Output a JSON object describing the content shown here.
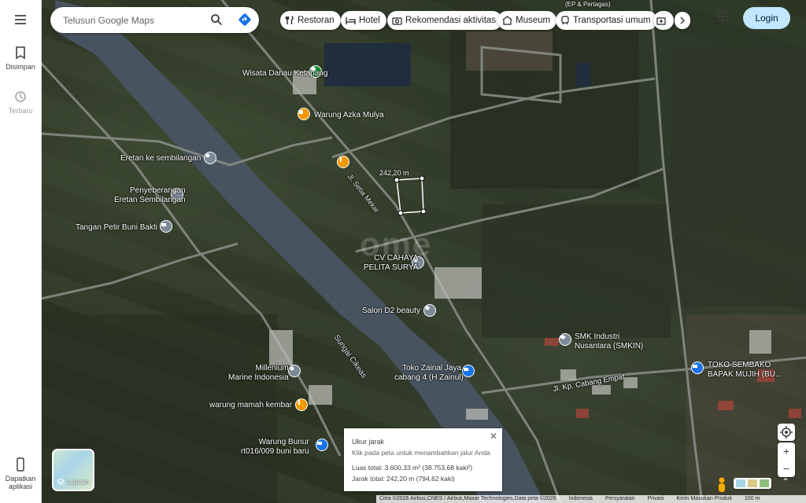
{
  "rail": {
    "saved_label": "Disimpan",
    "recent_label": "Terbaru",
    "get_app_label": "Dapatkan aplikasi"
  },
  "search": {
    "placeholder": "Telusuri Google Maps"
  },
  "chips": [
    "Restoran",
    "Hotel",
    "Rekomendasi aktivitas",
    "Museum",
    "Transportasi umum"
  ],
  "login_label": "Login",
  "places": {
    "wisata": "Wisata Danau Ketapang",
    "azka": "Warung Azka Mulya",
    "eretan": "Eretan ke sembilangan",
    "penyeberangan_1": "Penyeberangan",
    "penyeberangan_2": "Eretan Sembilangan",
    "tangan": "Tangan Petir Buni Bakti",
    "cahaya_1": "CV CAHAYA",
    "cahaya_2": "PELITA SURYA",
    "salon": "Salon D2 beauty",
    "smk_1": "SMK Industri",
    "smk_2": "Nusantara (SMKIN)",
    "toko_zainal_1": "Toko Zainal Jaya,",
    "toko_zainal_2": "cabang 4 (H Zainul)",
    "toko_sembako_1": "TOKO SEMBAKO",
    "toko_sembako_2": "BAPAK MUJIH (BU...",
    "millenium_1": "Millenium",
    "millenium_2": "Marine Indonesia",
    "mamah": "warung mamah kembar",
    "bunur_1": "Warung Bunur",
    "bunur_2": "rt016/009 buni baru",
    "pertagas": "(EP & Pertagas)",
    "road_setia": "Jl. Setia Mekar",
    "road_cabang": "Jl. Kp. Cabang Empat",
    "river": "Sungai Cikeas"
  },
  "measure_label": "242,20 m",
  "watermark": "ome",
  "measure_popup": {
    "title": "Ukur jarak",
    "hint": "Klik pada peta untuk menambahkan jalur Anda",
    "area": "Luas total: 3.600,33 m² (38.753,68 kaki²)",
    "distance": "Jarak total: 242,20 m (794,62 kaki)"
  },
  "layers_label": "Lapisan",
  "footer": {
    "imagery": "Citra ©2026 Airbus,CNES / Airbus,Maxar Technologies,Data peta ©2026",
    "country": "Indonesia",
    "terms": "Persyaratan",
    "privacy": "Privasi",
    "feedback": "Kirim Masukan Produk",
    "scale": "100 m"
  },
  "colors": {
    "accent_blue": "#1a73e8",
    "login_bg": "#c2e7ff",
    "pin_teal": "#12b5cb",
    "pin_orange": "#f29900",
    "pin_gray": "#7c8a98",
    "pin_blue": "#1a73e8",
    "pin_green": "#1e8e3e"
  }
}
